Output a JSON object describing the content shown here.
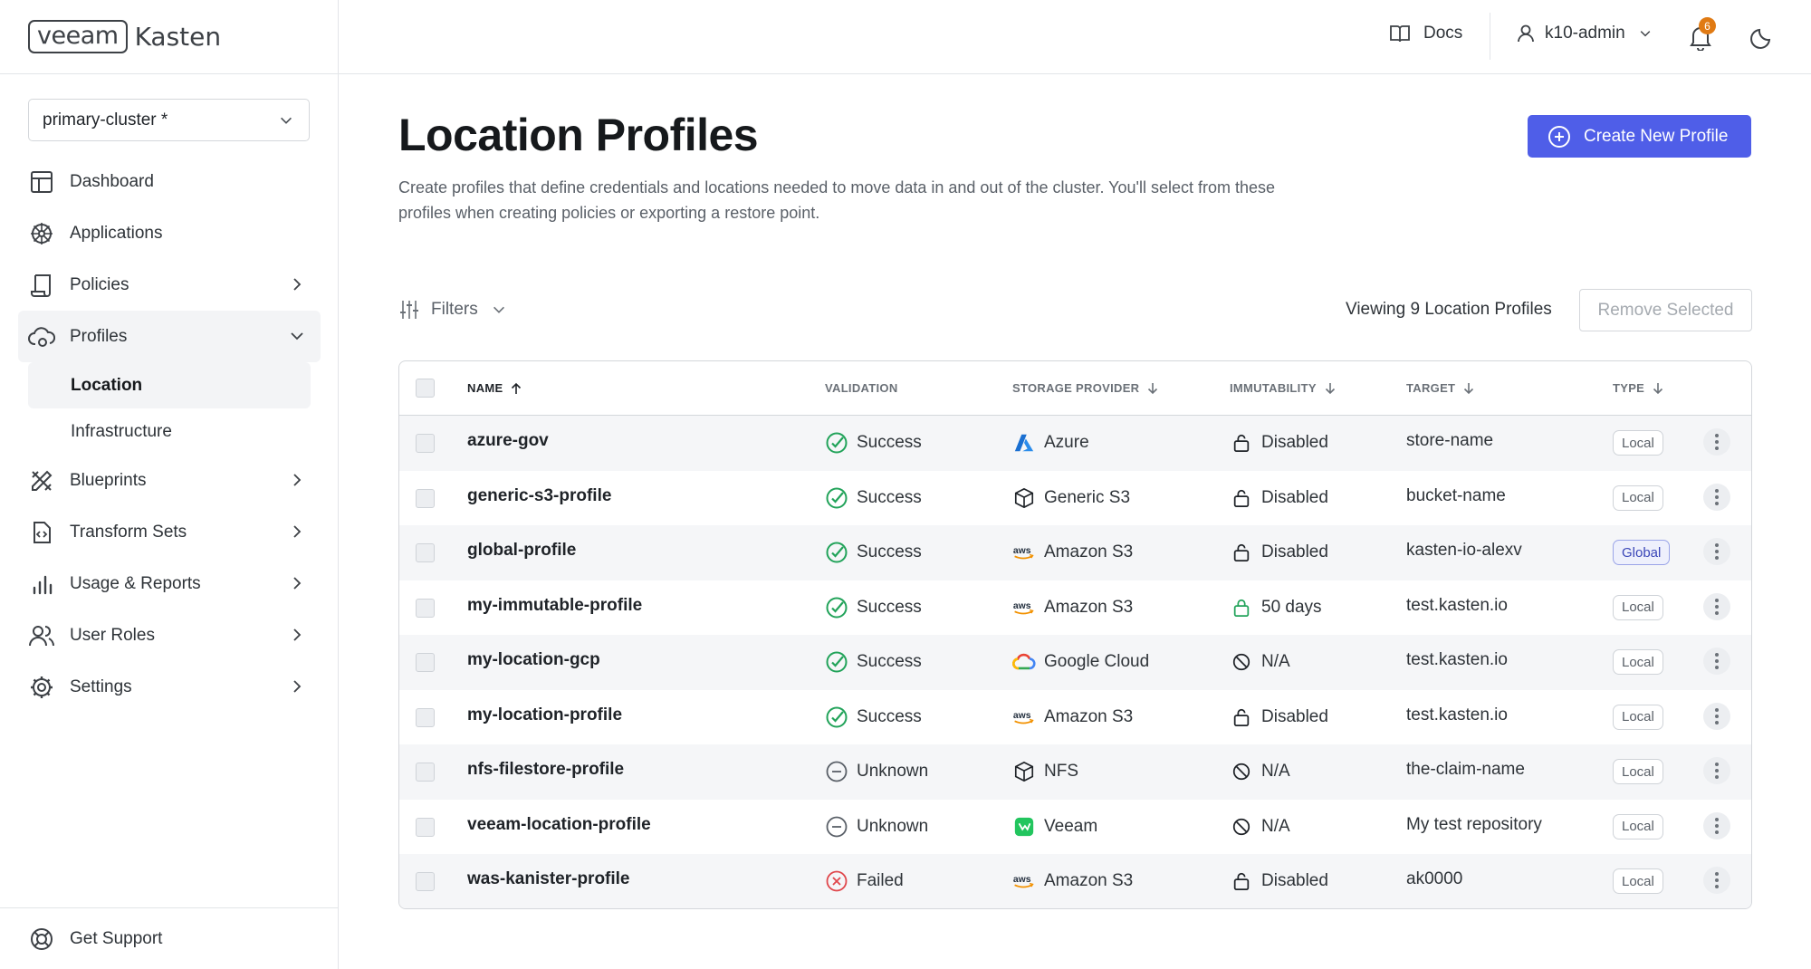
{
  "brand": {
    "logo_box": "veeam",
    "logo_text": "Kasten"
  },
  "sidebar": {
    "cluster": "primary-cluster *",
    "items": [
      {
        "label": "Dashboard",
        "icon": "dashboard-icon"
      },
      {
        "label": "Applications",
        "icon": "applications-icon"
      },
      {
        "label": "Policies",
        "icon": "policies-icon"
      },
      {
        "label": "Profiles",
        "icon": "profiles-icon"
      },
      {
        "label": "Blueprints",
        "icon": "blueprints-icon"
      },
      {
        "label": "Transform Sets",
        "icon": "transform-sets-icon"
      },
      {
        "label": "Usage & Reports",
        "icon": "usage-reports-icon"
      },
      {
        "label": "User Roles",
        "icon": "user-roles-icon"
      },
      {
        "label": "Settings",
        "icon": "settings-icon"
      }
    ],
    "profile_sub": [
      "Location",
      "Infrastructure"
    ],
    "support": "Get Support"
  },
  "header": {
    "docs": "Docs",
    "user": "k10-admin",
    "notifications": "6"
  },
  "main": {
    "title": "Location Profiles",
    "description": "Create profiles that define credentials and locations needed to move data in and out of the cluster. You'll select from these profiles when creating policies or exporting a restore point.",
    "create_button": "Create New Profile",
    "filters": "Filters",
    "viewing": "Viewing 9 Location Profiles",
    "remove_button": "Remove Selected"
  },
  "table": {
    "headers": {
      "name": "NAME",
      "validation": "VALIDATION",
      "provider": "STORAGE PROVIDER",
      "immutability": "IMMUTABILITY",
      "target": "TARGET",
      "type": "TYPE"
    },
    "rows": [
      {
        "name": "azure-gov",
        "validation": "Success",
        "provider": "Azure",
        "immutability": "Disabled",
        "target": "store-name",
        "type": "Local"
      },
      {
        "name": "generic-s3-profile",
        "validation": "Success",
        "provider": "Generic S3",
        "immutability": "Disabled",
        "target": "bucket-name",
        "type": "Local"
      },
      {
        "name": "global-profile",
        "validation": "Success",
        "provider": "Amazon S3",
        "immutability": "Disabled",
        "target": "kasten-io-alexv",
        "type": "Global"
      },
      {
        "name": "my-immutable-profile",
        "validation": "Success",
        "provider": "Amazon S3",
        "immutability": "50 days",
        "target": "test.kasten.io",
        "type": "Local"
      },
      {
        "name": "my-location-gcp",
        "validation": "Success",
        "provider": "Google Cloud",
        "immutability": "N/A",
        "target": "test.kasten.io",
        "type": "Local"
      },
      {
        "name": "my-location-profile",
        "validation": "Success",
        "provider": "Amazon S3",
        "immutability": "Disabled",
        "target": "test.kasten.io",
        "type": "Local"
      },
      {
        "name": "nfs-filestore-profile",
        "validation": "Unknown",
        "provider": "NFS",
        "immutability": "N/A",
        "target": "the-claim-name",
        "type": "Local"
      },
      {
        "name": "veeam-location-profile",
        "validation": "Unknown",
        "provider": "Veeam",
        "immutability": "N/A",
        "target": "My test repository",
        "type": "Local"
      },
      {
        "name": "was-kanister-profile",
        "validation": "Failed",
        "provider": "Amazon S3",
        "immutability": "Disabled",
        "target": "ak0000",
        "type": "Local"
      }
    ]
  },
  "colors": {
    "accent": "#4f5ee8",
    "success": "#22a35a",
    "failed": "#e0474c",
    "badge": "#e07a13"
  }
}
